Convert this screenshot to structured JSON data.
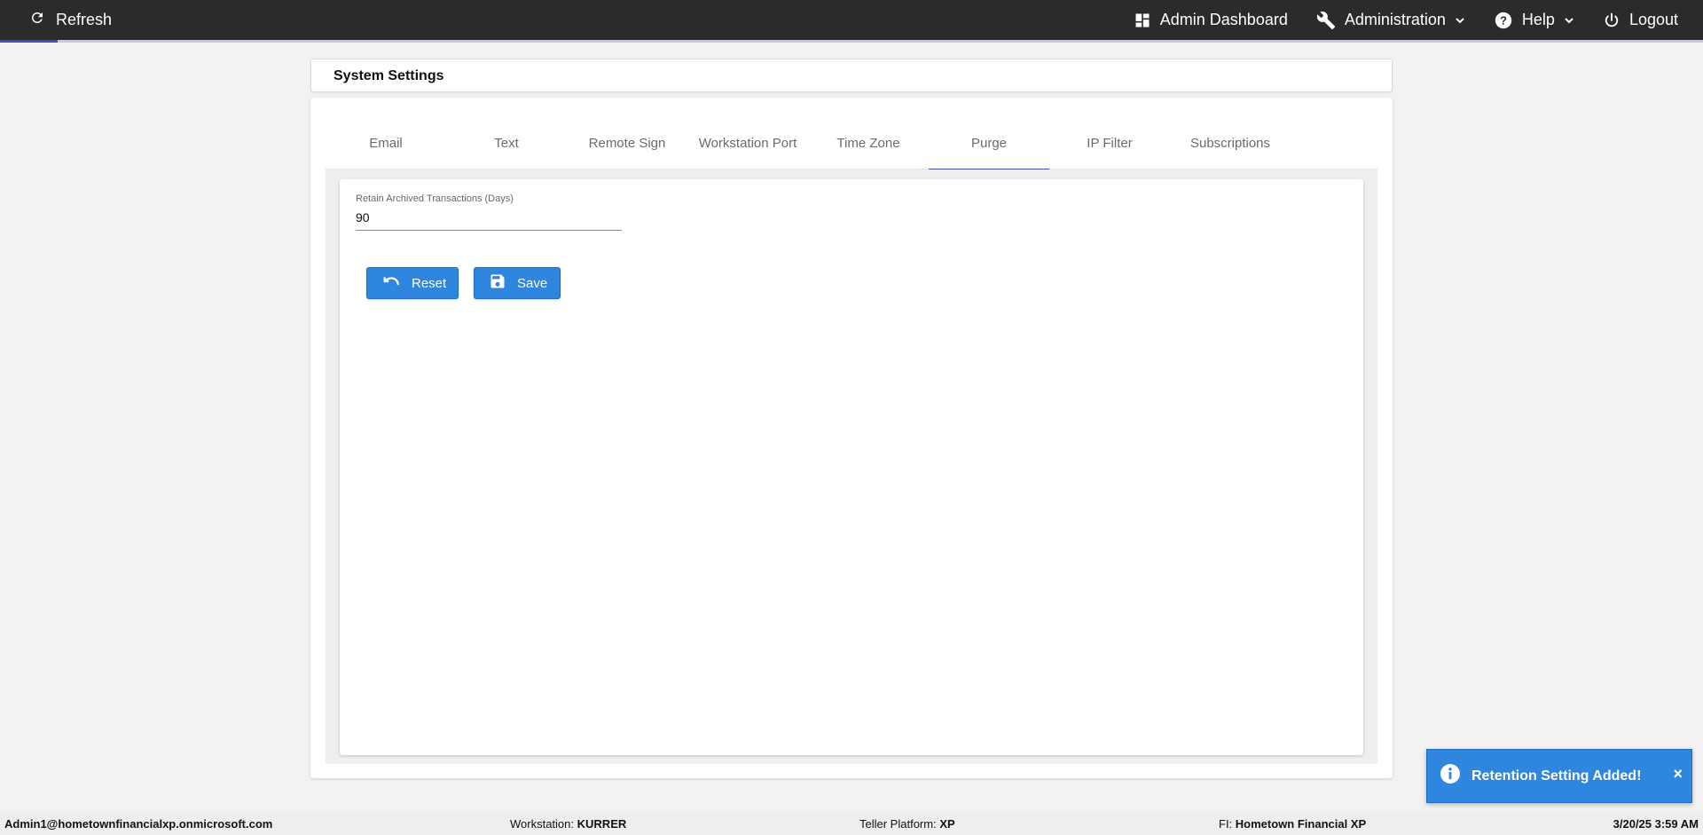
{
  "topbar": {
    "refresh_label": "Refresh",
    "refresh_icon": "refresh-icon",
    "loading_progress": 0.034,
    "nav": {
      "admin_dashboard": "Admin Dashboard",
      "administration": "Administration",
      "help": "Help",
      "logout": "Logout"
    }
  },
  "page": {
    "title": "System Settings"
  },
  "tabs": [
    {
      "label": "Email"
    },
    {
      "label": "Text"
    },
    {
      "label": "Remote Sign"
    },
    {
      "label": "Workstation Port"
    },
    {
      "label": "Time Zone"
    },
    {
      "label": "Purge",
      "active": true
    },
    {
      "label": "IP Filter"
    },
    {
      "label": "Subscriptions"
    }
  ],
  "purge": {
    "retain_label": "Retain Archived Transactions (Days)",
    "retain_value": "90",
    "reset_label": "Reset",
    "save_label": "Save"
  },
  "toast": {
    "message": "Retention Setting Added!",
    "close": "×"
  },
  "footer": {
    "user": "Admin1@hometownfinancialxp.onmicrosoft.com",
    "workstation_label": "Workstation:",
    "workstation_value": "KURRER",
    "platform_label": "Teller Platform:",
    "platform_value": "XP",
    "fi_label": "FI:",
    "fi_value": "Hometown Financial XP",
    "datetime": "3/20/25 3:59 AM"
  },
  "colors": {
    "topbar_bg": "#2b2b2b",
    "accent": "#3f51b5",
    "button": "#2e86de"
  }
}
